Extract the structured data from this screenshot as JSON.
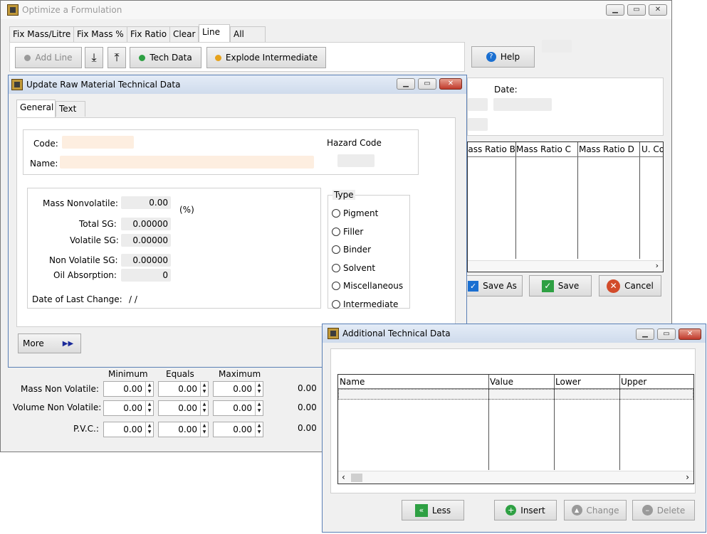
{
  "main": {
    "title": "Optimize a Formulation",
    "tabs": [
      "Fix Mass/Litre",
      "Fix Mass %",
      "Fix Ratio",
      "Clear",
      "Line",
      "All"
    ],
    "toolbar": {
      "add_line": "Add Line",
      "tech_data": "Tech Data",
      "explode": "Explode Intermediate"
    },
    "help": "Help",
    "date_label": "Date:",
    "grid_columns": [
      "Mass Ratio B",
      "Mass Ratio C",
      "Mass Ratio D",
      "U. Co"
    ],
    "actions": {
      "save_as": "Save As",
      "save": "Save",
      "cancel": "Cancel"
    },
    "constraints": {
      "headers": [
        "Minimum",
        "Equals",
        "Maximum"
      ],
      "rows": [
        {
          "label": "Mass Non Volatile:",
          "min": "0.00",
          "eq": "0.00",
          "max": "0.00",
          "result": "0.00"
        },
        {
          "label": "Volume Non Volatile:",
          "min": "0.00",
          "eq": "0.00",
          "max": "0.00",
          "result": "0.00"
        },
        {
          "label": "P.V.C.:",
          "min": "0.00",
          "eq": "0.00",
          "max": "0.00",
          "result": "0.00"
        }
      ]
    }
  },
  "raw": {
    "title": "Update Raw Material Technical Data",
    "tabs": [
      "General",
      "Text"
    ],
    "code_label": "Code:",
    "name_label": "Name:",
    "hazard_label": "Hazard Code",
    "mass_nonvolatile_label": "Mass Nonvolatile:",
    "mass_nonvolatile": "0.00",
    "percent": "(%)",
    "total_sg_label": "Total SG:",
    "total_sg": "0.00000",
    "volatile_sg_label": "Volatile SG:",
    "volatile_sg": "0.00000",
    "non_volatile_sg_label": "Non Volatile SG:",
    "non_volatile_sg": "0.00000",
    "oil_absorption_label": "Oil Absorption:",
    "oil_absorption": "0",
    "date_change_label": "Date of Last Change:",
    "date_change": "/ /",
    "type_label": "Type",
    "types": [
      "Pigment",
      "Filler",
      "Binder",
      "Solvent",
      "Miscellaneous",
      "Intermediate"
    ],
    "more": "More"
  },
  "additional": {
    "title": "Additional Technical Data",
    "columns": [
      "Name",
      "Value",
      "Lower",
      "Upper"
    ],
    "buttons": {
      "less": "Less",
      "insert": "Insert",
      "change": "Change",
      "delete": "Delete"
    }
  },
  "colors": {
    "titlebar": "#dde4ef",
    "accent": "#1a6fd1",
    "green": "#2ea043",
    "red": "#d24b2a",
    "orange": "#e6a21c"
  }
}
